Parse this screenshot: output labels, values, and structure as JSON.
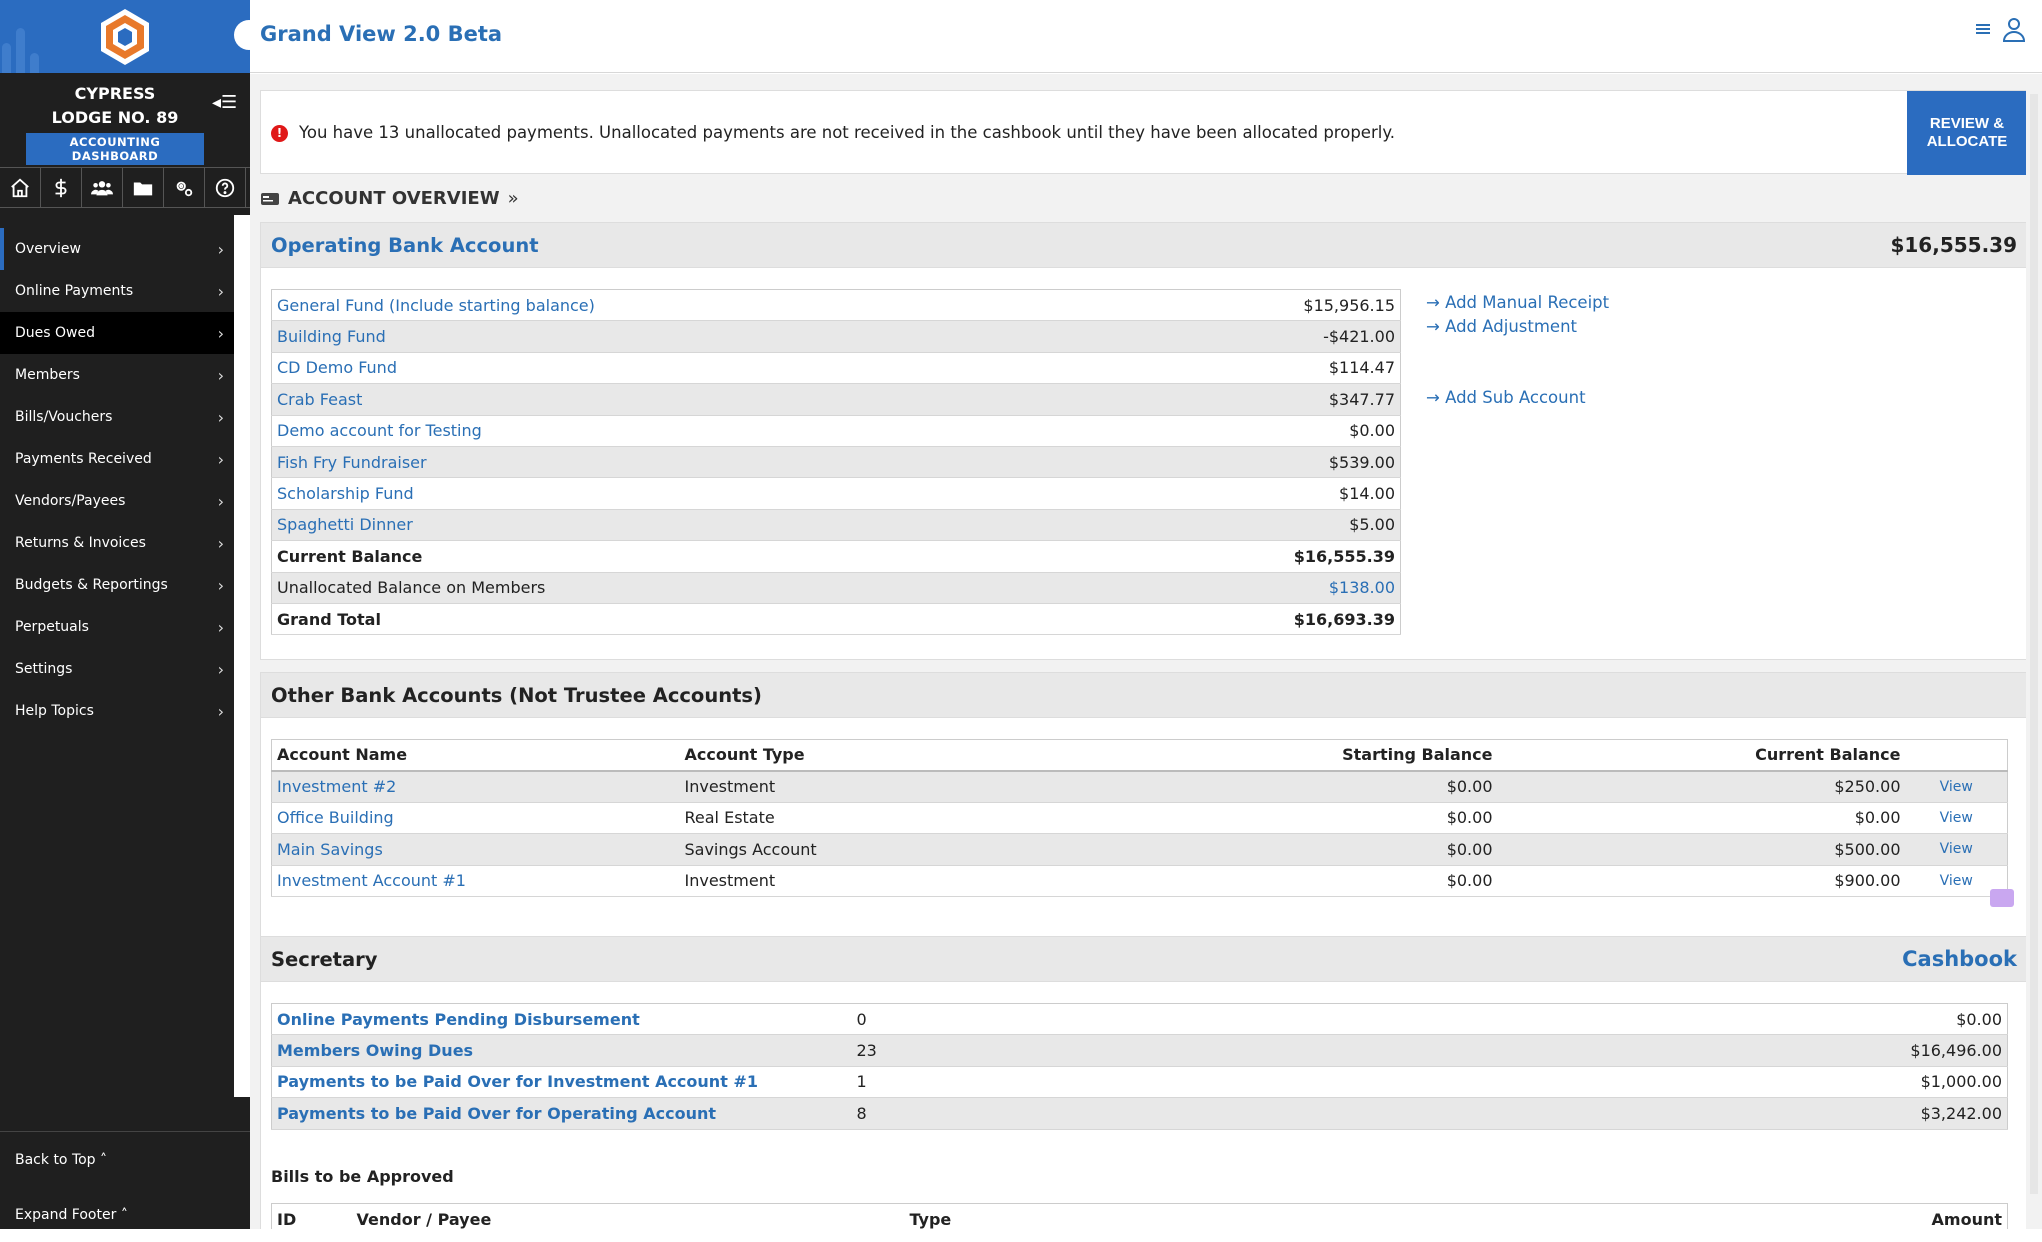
{
  "app": {
    "title": "Grand View 2.0 Beta"
  },
  "sidebar": {
    "lodge_line1": "CYPRESS",
    "lodge_line2": "LODGE NO. 89",
    "badge": "ACCOUNTING DASHBOARD",
    "icons": [
      "home-icon",
      "dollar-icon",
      "members-icon",
      "folder-icon",
      "settings-icon",
      "help-icon"
    ],
    "items": [
      {
        "label": "Overview"
      },
      {
        "label": "Online Payments"
      },
      {
        "label": "Dues Owed"
      },
      {
        "label": "Members"
      },
      {
        "label": "Bills/Vouchers"
      },
      {
        "label": "Payments Received"
      },
      {
        "label": "Vendors/Payees"
      },
      {
        "label": "Returns & Invoices"
      },
      {
        "label": "Budgets & Reportings"
      },
      {
        "label": "Perpetuals"
      },
      {
        "label": "Settings"
      },
      {
        "label": "Help Topics"
      }
    ],
    "footer": {
      "back_to_top": "Back to Top",
      "expand_footer": "Expand Footer"
    }
  },
  "alert": {
    "text": "You have 13 unallocated payments. Unallocated payments are not received in the cashbook until they have been allocated properly.",
    "button_line1": "REVIEW &",
    "button_line2": "ALLOCATE"
  },
  "overview": {
    "heading": "ACCOUNT OVERVIEW"
  },
  "operating": {
    "title": "Operating Bank Account",
    "total": "$16,555.39",
    "funds": [
      {
        "name": "General Fund (Include starting balance)",
        "amount": "$15,956.15"
      },
      {
        "name": "Building Fund",
        "amount": "-$421.00"
      },
      {
        "name": "CD Demo Fund",
        "amount": "$114.47"
      },
      {
        "name": "Crab Feast",
        "amount": "$347.77"
      },
      {
        "name": "Demo account for Testing",
        "amount": "$0.00"
      },
      {
        "name": "Fish Fry Fundraiser",
        "amount": "$539.00"
      },
      {
        "name": "Scholarship Fund",
        "amount": "$14.00"
      },
      {
        "name": "Spaghetti Dinner",
        "amount": "$5.00"
      }
    ],
    "current_balance_label": "Current Balance",
    "current_balance": "$16,555.39",
    "unallocated_label": "Unallocated Balance on Members",
    "unallocated": "$138.00",
    "grand_total_label": "Grand Total",
    "grand_total": "$16,693.39",
    "links": {
      "manual_receipt": "Add Manual Receipt",
      "adjustment": "Add Adjustment",
      "sub_account": "Add Sub Account"
    }
  },
  "other_accounts": {
    "title": "Other Bank Accounts (Not Trustee Accounts)",
    "columns": {
      "name": "Account Name",
      "type": "Account Type",
      "starting": "Starting Balance",
      "current": "Current Balance"
    },
    "view_label": "View",
    "rows": [
      {
        "name": "Investment #2",
        "type": "Investment",
        "starting": "$0.00",
        "current": "$250.00"
      },
      {
        "name": "Office Building",
        "type": "Real Estate",
        "starting": "$0.00",
        "current": "$0.00"
      },
      {
        "name": "Main Savings",
        "type": "Savings Account",
        "starting": "$0.00",
        "current": "$500.00"
      },
      {
        "name": "Investment Account #1",
        "type": "Investment",
        "starting": "$0.00",
        "current": "$900.00"
      }
    ]
  },
  "secretary": {
    "title": "Secretary",
    "cashbook": "Cashbook",
    "rows": [
      {
        "label": "Online Payments Pending Disbursement",
        "count": "0",
        "amount": "$0.00"
      },
      {
        "label": "Members Owing Dues",
        "count": "23",
        "amount": "$16,496.00"
      },
      {
        "label": "Payments to be Paid Over for Investment Account #1",
        "count": "1",
        "amount": "$1,000.00"
      },
      {
        "label": "Payments to be Paid Over for Operating Account",
        "count": "8",
        "amount": "$3,242.00"
      }
    ],
    "bills_heading": "Bills to be Approved",
    "bills_columns": {
      "id": "ID",
      "vendor": "Vendor / Payee",
      "type": "Type",
      "amount": "Amount"
    }
  }
}
